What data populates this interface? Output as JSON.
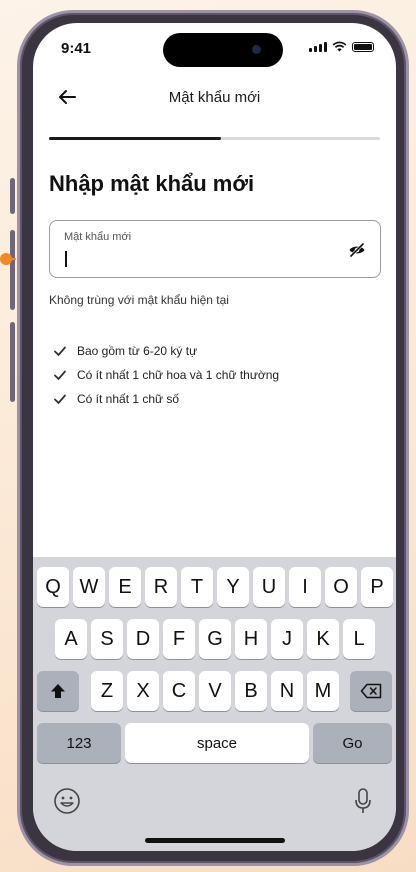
{
  "status": {
    "time": "9:41"
  },
  "nav": {
    "title": "Mật khẩu mới"
  },
  "progress": {
    "value": 0.52
  },
  "page": {
    "heading": "Nhập mật khẩu mới"
  },
  "password_field": {
    "label": "Mật khẩu mới",
    "value": ""
  },
  "helper_text": "Không trùng với mật khẩu hiện tại",
  "rules": [
    {
      "text": "Bao gồm từ 6-20 ký tự"
    },
    {
      "text": "Có ít nhất 1 chữ hoa và 1 chữ thường"
    },
    {
      "text": "Có ít nhất 1 chữ số"
    }
  ],
  "keyboard": {
    "row1": [
      "Q",
      "W",
      "E",
      "R",
      "T",
      "Y",
      "U",
      "I",
      "O",
      "P"
    ],
    "row2": [
      "A",
      "S",
      "D",
      "F",
      "G",
      "H",
      "J",
      "K",
      "L"
    ],
    "row3": [
      "Z",
      "X",
      "C",
      "V",
      "B",
      "N",
      "M"
    ],
    "numbers_key": "123",
    "space_key": "space",
    "go_key": "Go"
  },
  "icons": {
    "back": "arrow-left-icon",
    "eye": "eye-slash-icon",
    "check": "check-icon",
    "shift": "shift-icon",
    "backspace": "backspace-icon",
    "emoji": "emoji-icon",
    "mic": "microphone-icon"
  }
}
